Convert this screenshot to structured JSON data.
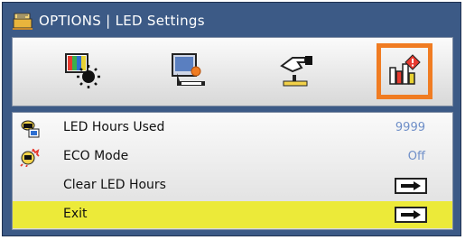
{
  "window": {
    "title": "OPTIONS | LED Settings"
  },
  "tabs": [
    {
      "icon": "picture-brightness-icon",
      "active": false
    },
    {
      "icon": "display-screen-icon",
      "active": false
    },
    {
      "icon": "setup-hand-icon",
      "active": false
    },
    {
      "icon": "options-chart-icon",
      "active": true
    }
  ],
  "menu": {
    "items": [
      {
        "label": "LED Hours Used",
        "value": "9999",
        "icon": "led-hours-icon"
      },
      {
        "label": "ECO Mode",
        "value": "Off",
        "icon": "eco-mode-icon"
      },
      {
        "label": "Clear LED Hours",
        "action": "arrow-right-icon"
      },
      {
        "label": "Exit",
        "action": "arrow-right-icon",
        "selected": true
      }
    ]
  },
  "colors": {
    "frame": "#3c5a86",
    "accent": "#f07c22",
    "selected": "#ecea39",
    "value": "#6f8fc8"
  }
}
